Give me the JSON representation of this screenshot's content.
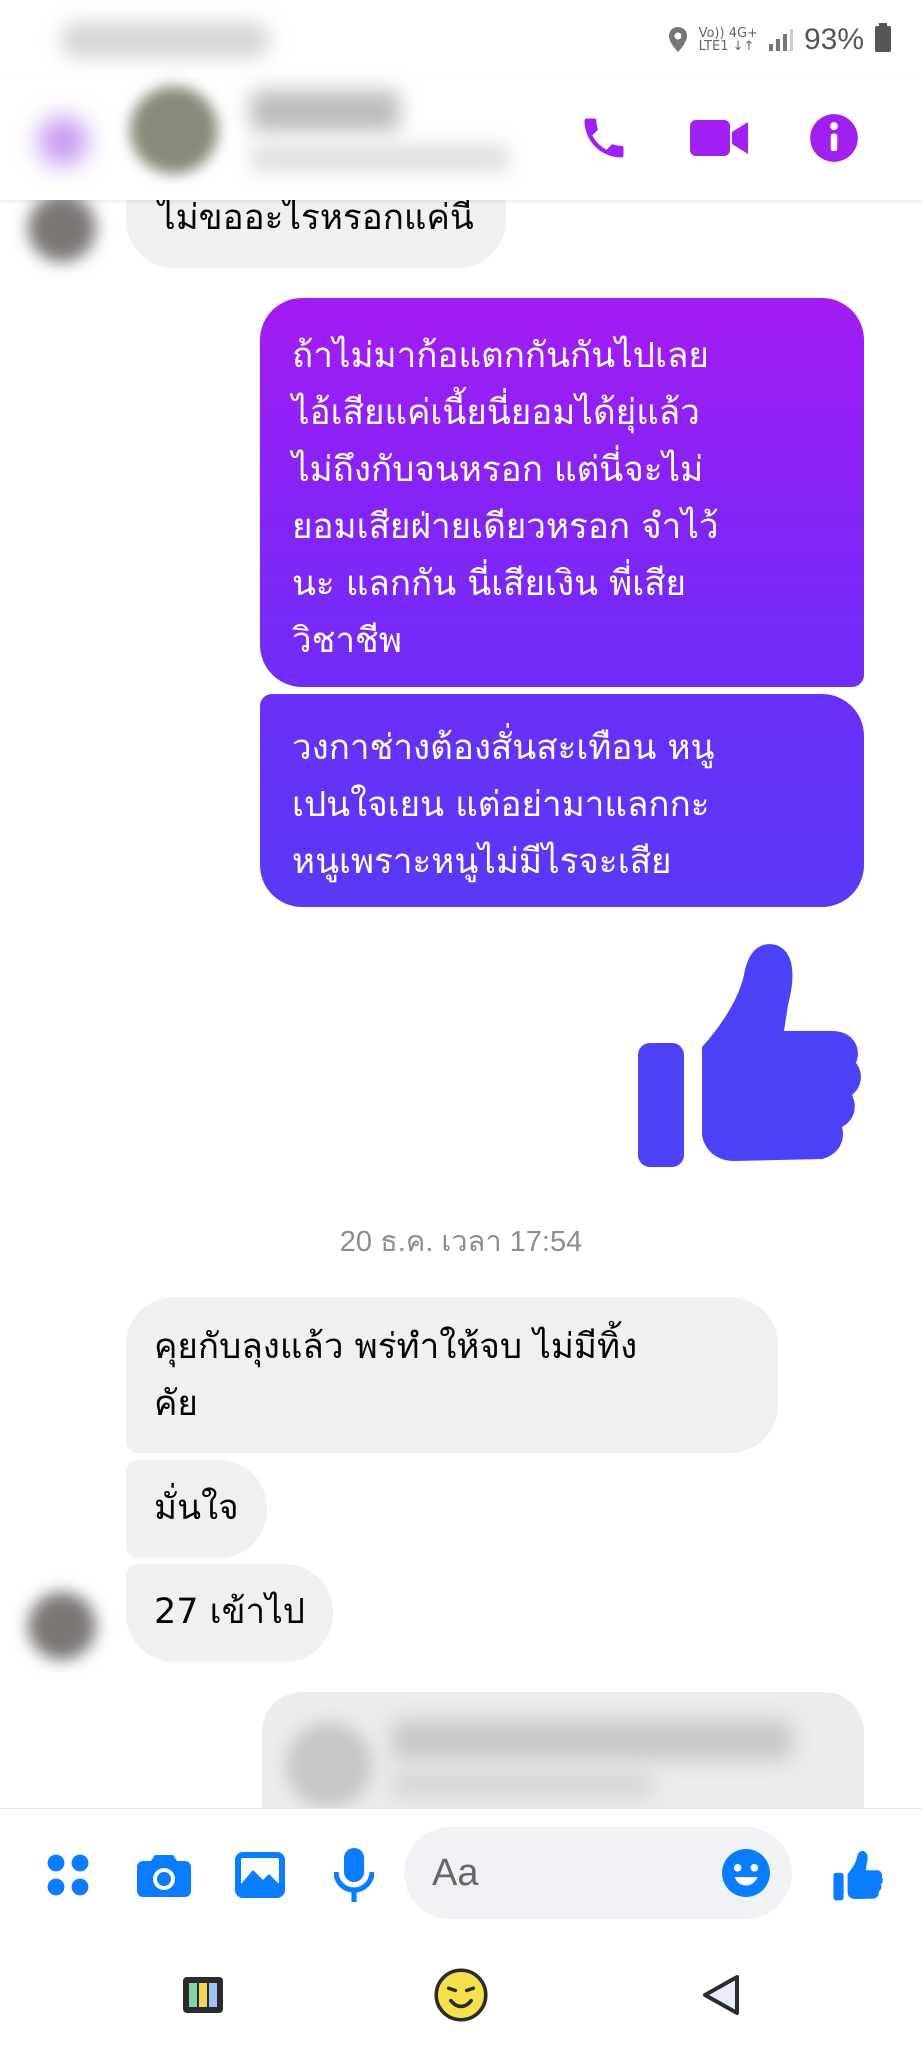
{
  "status_bar": {
    "network_top": "Vo))  4G+",
    "network_bottom": "LTE1  ↓↑",
    "battery": "93%"
  },
  "header": {
    "icons": [
      "phone-icon",
      "video-camera-icon",
      "info-icon"
    ],
    "accent_color": "#a020f0"
  },
  "messages": [
    {
      "direction": "in",
      "text": "ไม่ขออะไรหรอกแค่นี้"
    },
    {
      "direction": "out",
      "text": "ถ้าไม่มาก้อแตกกันกันไปเลย\nไอ้เสียแค่เนี้ยนี่ยอมได้ยุ่แล้ว\nไม่ถึงกับจนหรอก    แต่นี่จะไม่\nยอมเสียฝ่ายเดียวหรอก  จำไว้\nนะ  แลกกัน นี่เสียเงิน พี่เสีย\nวิชาชีพ"
    },
    {
      "direction": "out",
      "text": "วงกาช่างต้องสั่นสะเทือน  หนู\nเปนใจเยน  แต่อย่ามาแลกกะ\nหนูเพราะหนูไม่มีไรจะเสีย"
    },
    {
      "direction": "out",
      "type": "like-sticker",
      "icon": "thumbs-up-icon"
    },
    {
      "direction": "in",
      "text": "คุยกับลุงแล้ว พร่ทำให้จบ  ไม่มีทิ้ง\nคัย"
    },
    {
      "direction": "in",
      "text": "มั่นใจ"
    },
    {
      "direction": "in",
      "text": "27 เข้าไป"
    }
  ],
  "timestamp": "20 ธ.ค. เวลา 17:54",
  "composer": {
    "placeholder": "Aa",
    "icons": [
      "apps-icon",
      "camera-icon",
      "gallery-icon",
      "microphone-icon",
      "emoji-icon",
      "thumbs-up-icon"
    ],
    "accent_color": "#0a7cff"
  },
  "navbar": {
    "icons": [
      "recents-icon",
      "home-emoji-icon",
      "back-icon"
    ]
  }
}
